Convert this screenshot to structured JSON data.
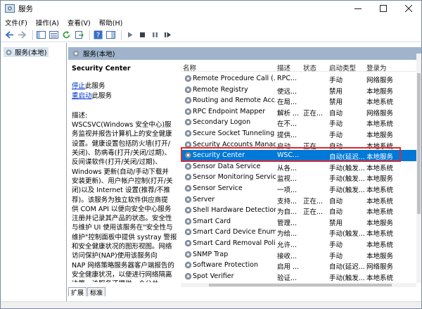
{
  "window": {
    "title": "服务"
  },
  "menu": [
    "文件(F)",
    "操作(A)",
    "查看(V)",
    "帮助(H)"
  ],
  "tree": {
    "root_label": "服务(本地)"
  },
  "panel": {
    "header": "服务(本地)"
  },
  "description": {
    "service_name": "Security Center",
    "stop_link": "停止",
    "stop_suffix": "此服务",
    "restart_link": "重启动",
    "restart_suffix": "此服务",
    "text": "描述:\nWSCSVC(Windows 安全中心)服\n务监视并报告计算机上的安全健康\n设置。健康设置包括防火墙(打开/\n关闭)、防病毒(打开/关闭/过期)、\n反间谍软件(打开/关闭/过期)、\nWindows 更新(自动/手动下载并\n安装更新)、用户帐户控制(打开/关\n闭)以及 Internet 设置(推荐/不推\n荐)。该服务为独立软件供应商提\n供 COM API 以便向安全中心服务\n注册并记录其产品的状态。安全性\n与维护 UI 使用该服务在\"安全性与\n维护\"控制面板中提供 systray 警报\n和安全健康状况的图形视图。网络\n访问保护(NAP)使用该服务向\nNAP 网络策略服务器客户端报告的\n安全健康状况，以便进行网络隔离\n决策。该服务还提供一个公共"
  },
  "columns": [
    "名称",
    "描述",
    "状态",
    "启动类型",
    "登录为"
  ],
  "services": [
    {
      "name": "Remote Procedure Call (...",
      "desc": "RPC...",
      "status": "",
      "startup": "手动",
      "logon": "网络服务"
    },
    {
      "name": "Remote Registry",
      "desc": "使远...",
      "status": "",
      "startup": "禁用",
      "logon": "本地服务"
    },
    {
      "name": "Routing and Remote Acc...",
      "desc": "在局...",
      "status": "",
      "startup": "禁用",
      "logon": "本地系统"
    },
    {
      "name": "RPC Endpoint Mapper",
      "desc": "解析 ...",
      "status": "正在...",
      "startup": "自动",
      "logon": "网络服务"
    },
    {
      "name": "Secondary Logon",
      "desc": "在不...",
      "status": "",
      "startup": "手动",
      "logon": "本地系统"
    },
    {
      "name": "Secure Socket Tunneling ...",
      "desc": "提供...",
      "status": "",
      "startup": "手动",
      "logon": "本地服务"
    },
    {
      "name": "Security Accounts Manag...",
      "desc": "启动...",
      "status": "正在...",
      "startup": "自动",
      "logon": "本地系统"
    },
    {
      "name": "Security Center",
      "desc": "WSC...",
      "status": "",
      "startup": "自动(延迟...",
      "logon": "本地服务",
      "selected": true
    },
    {
      "name": "Sensor Data Service",
      "desc": "从各...",
      "status": "",
      "startup": "手动(触发...",
      "logon": "本地系统"
    },
    {
      "name": "Sensor Monitoring Service",
      "desc": "监视...",
      "status": "",
      "startup": "手动(触发...",
      "logon": "本地服务"
    },
    {
      "name": "Sensor Service",
      "desc": "一项...",
      "status": "",
      "startup": "手动(触发...",
      "logon": "本地系统"
    },
    {
      "name": "Server",
      "desc": "支持...",
      "status": "正在...",
      "startup": "自动",
      "logon": "本地系统"
    },
    {
      "name": "Shell Hardware Detection",
      "desc": "为自...",
      "status": "正在...",
      "startup": "自动",
      "logon": "本地系统"
    },
    {
      "name": "Smart Card",
      "desc": "管理...",
      "status": "",
      "startup": "禁用",
      "logon": "本地服务"
    },
    {
      "name": "Smart Card Device Enum...",
      "desc": "为给...",
      "status": "",
      "startup": "手动(触发...",
      "logon": "本地系统"
    },
    {
      "name": "Smart Card Removal Poli...",
      "desc": "允许...",
      "status": "",
      "startup": "手动",
      "logon": "本地系统"
    },
    {
      "name": "SNMP Trap",
      "desc": "接收...",
      "status": "",
      "startup": "手动",
      "logon": "本地服务"
    },
    {
      "name": "Software Protection",
      "desc": "启用 ...",
      "status": "",
      "startup": "自动(延迟...",
      "logon": "网络服务"
    },
    {
      "name": "Spot Verifier",
      "desc": "验证...",
      "status": "",
      "startup": "手动(触发...",
      "logon": "本地系统"
    }
  ],
  "tabs": [
    "扩展",
    "标准"
  ],
  "colors": {
    "selection": "#0078d7",
    "highlight_box": "#e0282e",
    "panel_header": "#9fb4cc"
  }
}
